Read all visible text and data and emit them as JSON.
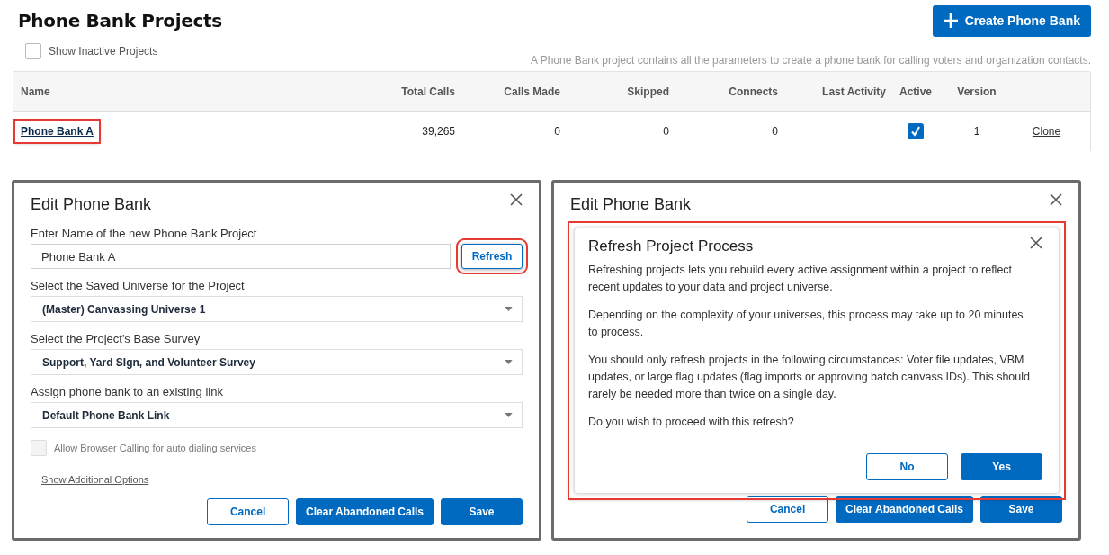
{
  "page": {
    "title": "Phone Bank Projects",
    "create_button": "Create Phone Bank",
    "show_inactive": {
      "label": "Show Inactive Projects",
      "checked": false
    },
    "description": "A Phone Bank project contains all the parameters to create a phone bank for calling voters and organization contacts."
  },
  "table": {
    "columns": [
      "Name",
      "Total Calls",
      "Calls Made",
      "Skipped",
      "Connects",
      "Last Activity",
      "Active",
      "Version"
    ],
    "rows": [
      {
        "name": "Phone Bank A",
        "highlighted": true,
        "total_calls": "39,265",
        "calls_made": "0",
        "skipped": "0",
        "connects": "0",
        "active": true,
        "version": "1",
        "action": "Clone"
      }
    ]
  },
  "edit_dialog": {
    "title": "Edit Phone Bank",
    "name_field": {
      "label": "Enter Name of the new Phone Bank Project",
      "value": "Phone Bank A"
    },
    "refresh_button": {
      "label": "Refresh",
      "highlighted": true
    },
    "selects": [
      {
        "label": "Select the Saved Universe for the Project",
        "value": "(Master) Canvassing Universe 1"
      },
      {
        "label": "Select the Project's Base Survey",
        "value": "Support, Yard SIgn, and Volunteer Survey"
      },
      {
        "label": "Assign phone bank to an existing link",
        "value": "Default Phone Bank Link"
      }
    ],
    "browser_calling": {
      "label": "Allow Browser Calling for auto dialing services",
      "checked": false,
      "disabled": true
    },
    "additional_options": "Show Additional Options",
    "buttons": [
      {
        "label": "Cancel",
        "kind": "secondary"
      },
      {
        "label": "Clear Abandoned Calls",
        "kind": "primary"
      },
      {
        "label": "Save",
        "kind": "primary"
      }
    ]
  },
  "edit_dialog_behind": {
    "title": "Edit Phone Bank",
    "refresh_dialog": {
      "title": "Refresh Project Process",
      "highlighted": true,
      "paragraphs": [
        "Refreshing projects lets you rebuild every active assignment within a project to reflect recent updates to your data and project universe.",
        "Depending on the complexity of your universes, this process may take up to 20 minutes to process.",
        "You should only refresh projects in the following circumstances: Voter file updates, VBM updates, or large flag updates (flag imports or approving batch canvass IDs). This should rarely be needed more than twice on a single day.",
        "Do you wish to proceed with this refresh?"
      ],
      "buttons": [
        {
          "label": "No",
          "kind": "secondary"
        },
        {
          "label": "Yes",
          "kind": "primary"
        }
      ]
    },
    "buttons": [
      {
        "label": "Cancel",
        "kind": "secondary"
      },
      {
        "label": "Clear Abandoned Calls",
        "kind": "primary"
      },
      {
        "label": "Save",
        "kind": "primary"
      }
    ]
  }
}
